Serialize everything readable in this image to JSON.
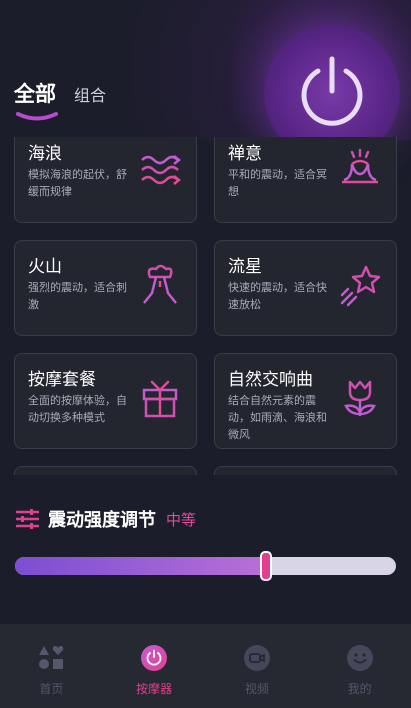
{
  "tabs": {
    "all": "全部",
    "combo": "组合"
  },
  "cards": [
    {
      "title": "海浪",
      "desc": "模拟海浪的起伏，舒缓而规律",
      "icon": "waves-icon"
    },
    {
      "title": "禅意",
      "desc": "平和的震动，适合冥想",
      "icon": "lotus-icon"
    },
    {
      "title": "火山",
      "desc": "强烈的震动，适合刺激",
      "icon": "volcano-icon"
    },
    {
      "title": "流星",
      "desc": "快速的震动，适合快速放松",
      "icon": "shooting-star-icon"
    },
    {
      "title": "按摩套餐",
      "desc": "全面的按摩体验，自动切换多种模式",
      "icon": "gift-icon"
    },
    {
      "title": "自然交响曲",
      "desc": "结合自然元素的震动，如雨滴、海浪和微风",
      "icon": "tulip-icon"
    }
  ],
  "intensity": {
    "title": "震动强度调节",
    "level_label": "中等",
    "value_fraction": 0.66
  },
  "nav": [
    {
      "label": "首页",
      "icon": "shapes-icon",
      "active": false
    },
    {
      "label": "按摩器",
      "icon": "power-icon",
      "active": true
    },
    {
      "label": "视频",
      "icon": "video-icon",
      "active": false
    },
    {
      "label": "我的",
      "icon": "smiley-icon",
      "active": false
    }
  ],
  "colors": {
    "accent": "#e0408f",
    "purple": "#7b4ed3",
    "background": "#1b1d2a"
  }
}
